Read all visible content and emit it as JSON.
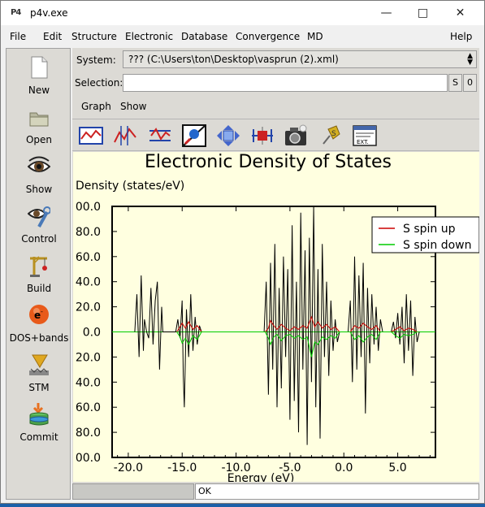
{
  "window": {
    "title": "p4v.exe",
    "icon_label": "P4"
  },
  "menubar": [
    "File",
    "Edit",
    "Structure",
    "Electronic",
    "Database",
    "Convergence",
    "MD",
    "Help"
  ],
  "tools": [
    {
      "label": "New",
      "icon": "new-document-icon"
    },
    {
      "label": "Open",
      "icon": "open-folder-icon"
    },
    {
      "label": "Show",
      "icon": "eye-icon"
    },
    {
      "label": "Control",
      "icon": "control-wrench-icon"
    },
    {
      "label": "Build",
      "icon": "crane-icon"
    },
    {
      "label": "DOS+bands",
      "icon": "electron-icon"
    },
    {
      "label": "STM",
      "icon": "stm-tip-icon"
    },
    {
      "label": "Commit",
      "icon": "database-commit-icon"
    }
  ],
  "system": {
    "label": "System:",
    "value": "??? (C:\\Users\\ton\\Desktop\\vasprun (2).xml)"
  },
  "selection": {
    "label": "Selection:",
    "value": "",
    "s_button": "S",
    "zero_button": "0"
  },
  "graph_menu": {
    "graph": "Graph",
    "show": "Show"
  },
  "toolbar_icons": [
    "graph-frame-icon",
    "curve-icon",
    "curve-lines-icon",
    "zoom-icon",
    "pan-arrows-icon",
    "scale-icon",
    "camera-icon",
    "pin-icon",
    "ext-icon"
  ],
  "status": {
    "text": "OK"
  },
  "colors": {
    "spin_up": "#cc0000",
    "spin_down": "#00cc00",
    "total": "#000000",
    "plot_bg": "#ffffe0"
  },
  "chart_data": {
    "type": "line",
    "title": "Electronic Density of States",
    "ylabel": "Density (states/eV)",
    "xlabel": "Energy (eV)",
    "xlim": [
      -21.5,
      8.5
    ],
    "ylim": [
      -100,
      100
    ],
    "xticks": [
      "-20.0",
      "-15.0",
      "-10.0",
      "-5.0",
      "0.0",
      "5.0"
    ],
    "xtick_values": [
      -20,
      -15,
      -10,
      -5,
      0,
      5
    ],
    "yticks": [
      "00.0",
      "80.0",
      "60.0",
      "40.0",
      "20.0",
      "0.0",
      "20.0",
      "40.0",
      "60.0",
      "80.0",
      "00.0"
    ],
    "ytick_values": [
      100,
      80,
      60,
      40,
      20,
      0,
      -20,
      -40,
      -60,
      -80,
      -100
    ],
    "legend_position": "top-right",
    "series": [
      {
        "name": "S spin up",
        "color": "#cc0000",
        "x": [
          -15.5,
          -15.2,
          -15.0,
          -14.7,
          -14.4,
          -14.0,
          -13.6,
          -13.2,
          -7.3,
          -7.0,
          -6.8,
          -6.5,
          -6.2,
          -5.8,
          -5.4,
          -5.0,
          -4.6,
          -4.2,
          -3.8,
          -3.4,
          -3.0,
          -2.7,
          -2.4,
          -2.0,
          -1.6,
          -1.2,
          -0.8,
          -0.4,
          0.6,
          1.0,
          1.4,
          1.8,
          2.2,
          2.6,
          3.0,
          3.4,
          4.4,
          4.8,
          5.2,
          5.6,
          6.0,
          6.4,
          6.8
        ],
        "y": [
          0,
          4,
          7,
          3,
          8,
          2,
          5,
          0,
          0,
          3,
          9,
          5,
          2,
          6,
          3,
          1,
          4,
          2,
          5,
          3,
          12,
          4,
          8,
          3,
          6,
          2,
          4,
          0,
          0,
          5,
          3,
          7,
          4,
          2,
          5,
          0,
          0,
          2,
          4,
          1,
          3,
          2,
          0
        ]
      },
      {
        "name": "S spin down",
        "color": "#00cc00",
        "x": [
          -15.5,
          -15.2,
          -15.0,
          -14.7,
          -14.4,
          -14.0,
          -13.6,
          -13.2,
          -7.3,
          -7.0,
          -6.8,
          -6.5,
          -6.2,
          -5.8,
          -5.4,
          -5.0,
          -4.6,
          -4.2,
          -3.8,
          -3.4,
          -3.0,
          -2.7,
          -2.4,
          -2.0,
          -1.6,
          -1.2,
          -0.8,
          -0.4,
          0.6,
          1.0,
          1.4,
          1.8,
          2.2,
          2.6,
          3.0,
          3.4,
          4.4,
          4.8,
          5.2,
          5.6,
          6.0,
          6.4,
          6.8
        ],
        "y": [
          0,
          -4,
          -9,
          -5,
          -10,
          -3,
          -6,
          0,
          0,
          -5,
          -10,
          -4,
          -2,
          -7,
          -3,
          -2,
          -5,
          -3,
          -6,
          -4,
          -20,
          -8,
          -10,
          -4,
          -6,
          -3,
          -5,
          0,
          0,
          -6,
          -3,
          -8,
          -4,
          -2,
          -6,
          0,
          0,
          -3,
          -5,
          -2,
          -3,
          -2,
          0
        ]
      },
      {
        "name": "",
        "color": "#000000",
        "x": [
          -19.4,
          -19.2,
          -19.0,
          -18.8,
          -18.6,
          -18.5,
          -18.3,
          -18.1,
          -17.9,
          -17.7,
          -17.5,
          -17.3,
          -17.1,
          -16.9,
          -16.8,
          -15.6,
          -15.4,
          -15.2,
          -15.0,
          -14.9,
          -14.8,
          -14.6,
          -14.4,
          -14.2,
          -14.0,
          -13.8,
          -13.6,
          -13.4,
          -13.2,
          -7.4,
          -7.2,
          -7.0,
          -6.8,
          -6.6,
          -6.4,
          -6.2,
          -6.0,
          -5.8,
          -5.6,
          -5.4,
          -5.2,
          -5.0,
          -4.8,
          -4.6,
          -4.4,
          -4.2,
          -4.0,
          -3.8,
          -3.6,
          -3.4,
          -3.2,
          -3.0,
          -2.8,
          -2.6,
          -2.4,
          -2.2,
          -2.0,
          -1.8,
          -1.6,
          -1.4,
          -1.2,
          -1.0,
          -0.8,
          -0.6,
          -0.4,
          0.4,
          0.6,
          0.8,
          1.0,
          1.2,
          1.4,
          1.6,
          1.8,
          2.0,
          2.2,
          2.4,
          2.6,
          2.8,
          3.0,
          3.2,
          3.4,
          3.6,
          4.4,
          4.6,
          4.8,
          5.0,
          5.2,
          5.4,
          5.6,
          5.8,
          6.0,
          6.2,
          6.4,
          6.6,
          6.8,
          7.0
        ],
        "y": [
          0,
          30,
          -20,
          45,
          -15,
          10,
          0,
          -5,
          35,
          -10,
          25,
          40,
          -30,
          20,
          0,
          0,
          10,
          -5,
          25,
          -35,
          -60,
          18,
          -20,
          30,
          -15,
          12,
          -10,
          5,
          0,
          0,
          40,
          -50,
          55,
          -30,
          70,
          -60,
          35,
          -45,
          60,
          -20,
          50,
          -70,
          85,
          -55,
          40,
          -80,
          95,
          -30,
          65,
          -90,
          75,
          -40,
          100,
          -60,
          50,
          -85,
          70,
          -20,
          40,
          -35,
          25,
          -15,
          10,
          -8,
          0,
          0,
          25,
          -40,
          60,
          -30,
          45,
          -20,
          55,
          -65,
          35,
          -25,
          30,
          -10,
          20,
          -15,
          10,
          0,
          0,
          8,
          -5,
          15,
          -10,
          20,
          -25,
          30,
          -15,
          25,
          -35,
          12,
          -8,
          0
        ]
      }
    ]
  }
}
